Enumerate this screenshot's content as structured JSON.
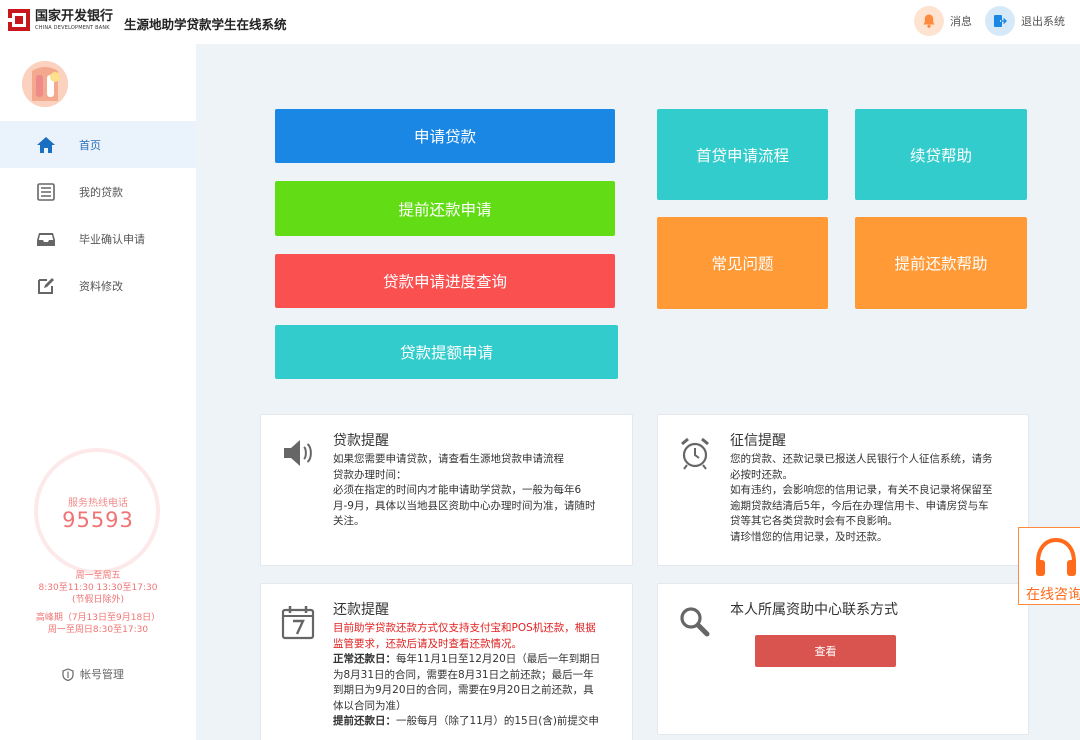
{
  "header": {
    "logo_cn": "国家开发银行",
    "logo_en": "CHINA DEVELOPMENT BANK",
    "system_title": "生源地助学贷款学生在线系统",
    "messages_label": "消息",
    "logout_label": "退出系统"
  },
  "sidebar": {
    "nav": [
      {
        "label": "首页",
        "icon": "home-icon",
        "active": true
      },
      {
        "label": "我的贷款",
        "icon": "list-icon"
      },
      {
        "label": "毕业确认申请",
        "icon": "inbox-icon"
      },
      {
        "label": "资料修改",
        "icon": "edit-icon"
      }
    ],
    "hotline_label": "服务热线电话",
    "hotline_number": "95593",
    "hours_line1": "周一至周五",
    "hours_line2": "8:30至11:30 13:30至17:30",
    "hours_line3": "(节假日除外)",
    "peak_line1": "高峰期（7月13日至9月18日）",
    "peak_line2": "周一至周日8:30至17:30",
    "account_label": "帐号管理"
  },
  "actions": {
    "apply_loan": "申请贷款",
    "early_repay_apply": "提前还款申请",
    "progress_query": "贷款申请进度查询",
    "increase_apply": "贷款提额申请",
    "first_loan_flow": "首贷申请流程",
    "renew_help": "续贷帮助",
    "faq": "常见问题",
    "early_repay_help": "提前还款帮助"
  },
  "cards": {
    "loan_reminder": {
      "title": "贷款提醒",
      "line1": "如果您需要申请贷款，请查看生源地贷款申请流程",
      "line2": "贷款办理时间：",
      "line3": "必须在指定的时间内才能申请助学贷款，一般为每年6",
      "line4": "月-9月，具体以当地县区资助中心办理时间为准，请随时",
      "line5": "关注。"
    },
    "credit_reminder": {
      "title": "征信提醒",
      "line1": "您的贷款、还款记录已报送人民银行个人征信系统，请务",
      "line2": "必按时还款。",
      "line3": "如有违约，会影响您的信用记录，有关不良记录将保留至",
      "line4": "逾期贷款结清后5年，今后在办理信用卡、申请房贷与车",
      "line5": "贷等其它各类贷款时会有不良影响。",
      "line6": "请珍惜您的信用记录，及时还款。"
    },
    "repay_reminder": {
      "title": "还款提醒",
      "red1": "目前助学贷款还款方式仅支持支付宝和POS机还款，根据",
      "red2": "监管要求，还款后请及时查看还款情况。",
      "normal_label": "正常还款日：",
      "normal1": "每年11月1日至12月20日（最后一年到期日",
      "normal2": "为8月31日的合同，需要在8月31日之前还款；最后一年",
      "normal3": "到期日为9月20日的合同，需要在9月20日之前还款，具",
      "normal4": "体以合同为准）",
      "early_label": "提前还款日：",
      "early1": "一般每月（除了11月）的15日(含)前提交申"
    },
    "contact": {
      "title": "本人所属资助中心联系方式",
      "view_label": "查看"
    }
  },
  "float": {
    "consult_label": "在线咨询"
  },
  "colors": {
    "blue": "#1a87e5",
    "green": "#62dd15",
    "red": "#fb5050",
    "cyan": "#33cccc",
    "orange": "#ff9a36",
    "view_button": "#d9534f"
  }
}
